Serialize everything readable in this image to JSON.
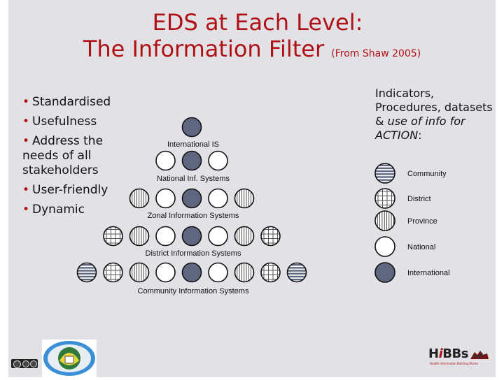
{
  "title": {
    "line1": "EDS at Each Level:",
    "line2": "The Information Filter",
    "citation": "(From Shaw 2005)"
  },
  "bullets": [
    "Standardised",
    "Usefulness",
    "Address the needs of all stakeholders",
    "User-friendly",
    "Dynamic"
  ],
  "right_text": {
    "plain": "Indicators, Procedures, datasets & ",
    "italic": "use of info for ACTION",
    "suffix": ":"
  },
  "diagram": {
    "rows": [
      {
        "label": "International IS",
        "circles": [
          "international"
        ]
      },
      {
        "label": "National Inf. Systems",
        "circles": [
          "national",
          "international",
          "national"
        ]
      },
      {
        "label": "Zonal Information Systems",
        "circles": [
          "province",
          "national",
          "international",
          "national",
          "province"
        ]
      },
      {
        "label": "District Information Systems",
        "circles": [
          "district",
          "province",
          "national",
          "international",
          "national",
          "province",
          "district"
        ]
      },
      {
        "label": "Community Information Systems",
        "circles": [
          "community",
          "district",
          "province",
          "national",
          "international",
          "national",
          "province",
          "district",
          "community"
        ]
      }
    ]
  },
  "legend": [
    {
      "key": "community",
      "label": "Community"
    },
    {
      "key": "district",
      "label": "District"
    },
    {
      "key": "province",
      "label": "Province"
    },
    {
      "key": "national",
      "label": "National"
    },
    {
      "key": "international",
      "label": "International"
    }
  ],
  "colors": {
    "title": "#b01117",
    "international_fill": "#5f6680",
    "community_stripe": "#5f6680",
    "background": "#e1e1e6"
  },
  "footer": {
    "license_icon": "creative-commons-icon",
    "logo": "emblem-logo",
    "hibbs_brand": "HiBBs",
    "hibbs_subtitle": "Health Information Building Blocks"
  }
}
